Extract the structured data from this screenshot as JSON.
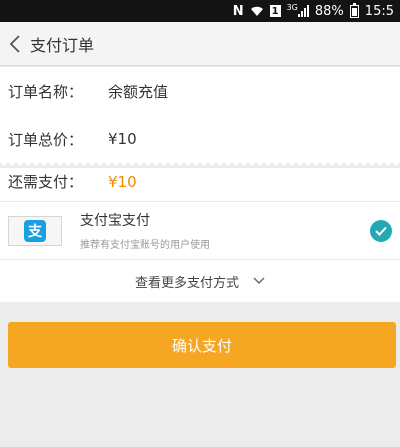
{
  "status_bar": {
    "nfc_label": "N",
    "sim_label": "1",
    "network_label": "3G",
    "battery_text": "88%",
    "time": "15:5"
  },
  "nav": {
    "title": "支付订单",
    "back_icon": "chevron-left-icon"
  },
  "order": {
    "name_label": "订单名称：",
    "name_value": "余额充值",
    "total_label": "订单总价：",
    "total_value": "¥10"
  },
  "payment": {
    "due_label": "还需支付：",
    "due_value": "¥10",
    "method_name": "支付宝支付",
    "method_desc": "推荐有支付宝账号的用户使用",
    "method_logo_glyph": "支",
    "method_selected": true,
    "more_methods_label": "查看更多支付方式"
  },
  "confirm_label": "确认支付",
  "colors": {
    "accent_orange": "#f5a623",
    "price_orange": "#f08a00",
    "check_teal": "#22a9b3",
    "alipay_blue": "#1a9fe0"
  }
}
